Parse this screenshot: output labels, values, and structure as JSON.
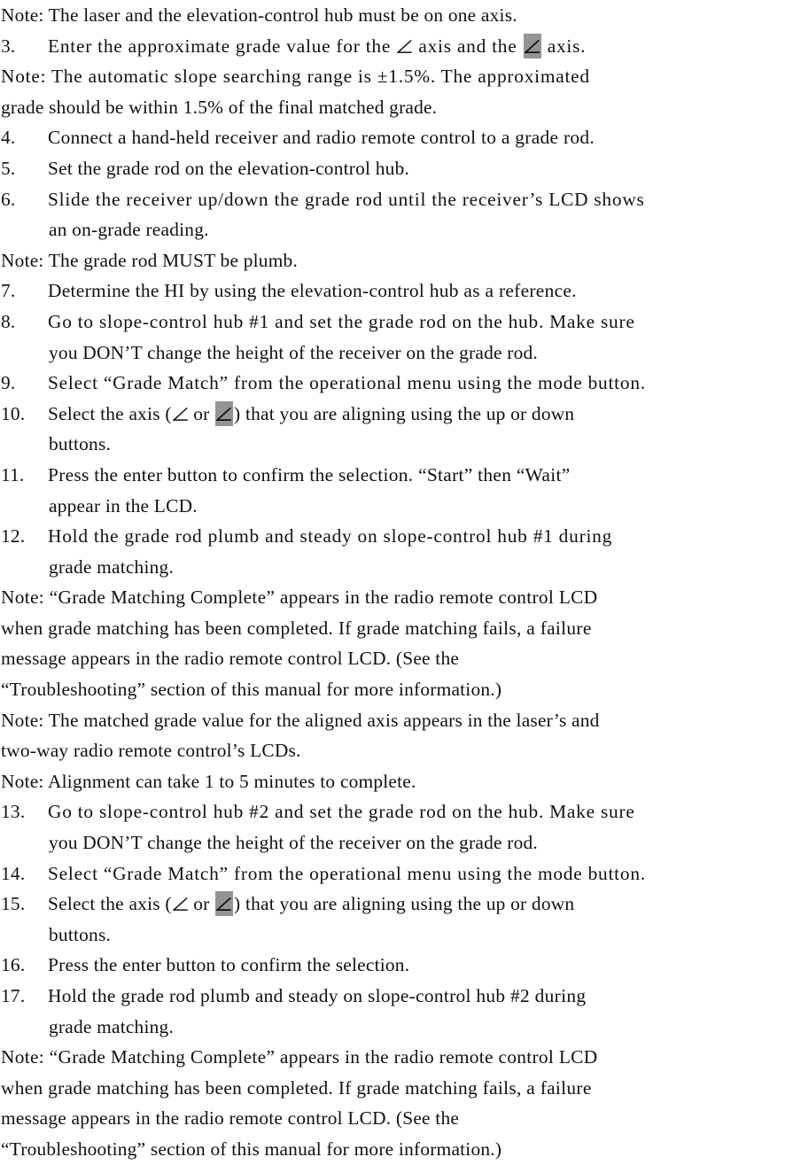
{
  "document": {
    "type": "instruction-manual-page",
    "symbols": {
      "angle_axis": "∠",
      "angle_axis_highlighted": "∠",
      "highlight_color": "#949494"
    },
    "lines": [
      {
        "id": "note-1",
        "kind": "note",
        "text": "Note: The laser and the elevation-control hub must be on one axis."
      },
      {
        "id": "step-3",
        "kind": "step",
        "number": "3.",
        "pre": "Enter the approximate grade value for the",
        "mid": "axis and the",
        "post": "axis.",
        "has_plain_angle": true,
        "has_boxed_angle": true
      },
      {
        "id": "note-2-l1",
        "kind": "note",
        "text": "Note: The automatic slope searching range is ±1.5%. The approximated"
      },
      {
        "id": "note-2-l2",
        "kind": "note-cont",
        "text": "grade should be within 1.5% of the final matched grade."
      },
      {
        "id": "step-4",
        "kind": "step",
        "number": "4.",
        "text": "Connect a hand-held receiver and radio remote control to a grade rod."
      },
      {
        "id": "step-5",
        "kind": "step",
        "number": "5.",
        "text": "Set the grade rod on the elevation-control hub."
      },
      {
        "id": "step-6-l1",
        "kind": "step",
        "number": "6.",
        "text": "Slide the receiver up/down the grade rod until the receiver’s LCD shows"
      },
      {
        "id": "step-6-l2",
        "kind": "step-cont",
        "text": "an on-grade reading."
      },
      {
        "id": "note-3",
        "kind": "note",
        "text": "Note: The grade rod MUST be plumb."
      },
      {
        "id": "step-7",
        "kind": "step",
        "number": "7.",
        "text": "Determine the HI by using the elevation-control hub as a reference."
      },
      {
        "id": "step-8-l1",
        "kind": "step",
        "number": "8.",
        "text": "Go to slope-control hub #1 and set the grade rod on the hub. Make sure"
      },
      {
        "id": "step-8-l2",
        "kind": "step-cont",
        "text": "you DON’T change the height of the receiver on the grade rod."
      },
      {
        "id": "step-9",
        "kind": "step",
        "number": "9.",
        "text": "Select “Grade Match” from the operational menu using the mode button."
      },
      {
        "id": "step-10-l1",
        "kind": "step",
        "number": "10.",
        "pre": "Select the axis (",
        "mid": "or",
        "post": ") that you are aligning using the up or down",
        "has_plain_angle": true,
        "has_boxed_angle": true
      },
      {
        "id": "step-10-l2",
        "kind": "step-cont",
        "text": "buttons."
      },
      {
        "id": "step-11-l1",
        "kind": "step",
        "number": "11.",
        "text": "Press the enter button to confirm the selection. “Start” then “Wait”"
      },
      {
        "id": "step-11-l2",
        "kind": "step-cont",
        "text": "appear in the LCD."
      },
      {
        "id": "step-12-l1",
        "kind": "step",
        "number": "12.",
        "text": "Hold the grade rod plumb and steady on slope-control hub #1 during"
      },
      {
        "id": "step-12-l2",
        "kind": "step-cont",
        "text": "grade matching."
      },
      {
        "id": "note-4-l1",
        "kind": "note",
        "text": "Note: “Grade Matching Complete” appears in the radio remote control LCD"
      },
      {
        "id": "note-4-l2",
        "kind": "note-cont",
        "text": "when grade matching has been completed. If grade matching fails, a failure"
      },
      {
        "id": "note-4-l3",
        "kind": "note-cont",
        "text": "message appears in the radio remote control LCD. (See the"
      },
      {
        "id": "note-4-l4",
        "kind": "note-cont",
        "text": "“Troubleshooting” section of this manual for more information.)"
      },
      {
        "id": "note-5-l1",
        "kind": "note",
        "text": "Note: The matched grade value for the aligned axis appears in the laser’s and"
      },
      {
        "id": "note-5-l2",
        "kind": "note-cont",
        "text": "two-way radio remote control’s LCDs."
      },
      {
        "id": "note-6",
        "kind": "note",
        "text": "Note: Alignment can take 1 to 5 minutes to complete."
      },
      {
        "id": "step-13-l1",
        "kind": "step",
        "number": "13.",
        "text": "Go to slope-control hub #2 and set the grade rod on the hub. Make sure"
      },
      {
        "id": "step-13-l2",
        "kind": "step-cont",
        "text": "you DON’T change the height of the receiver on the grade rod."
      },
      {
        "id": "step-14",
        "kind": "step",
        "number": "14.",
        "text": "Select “Grade Match” from the operational menu using the mode button."
      },
      {
        "id": "step-15-l1",
        "kind": "step",
        "number": "15.",
        "pre": "Select the axis (",
        "mid": "or",
        "post": ") that you are aligning using the up or down",
        "has_plain_angle": true,
        "has_boxed_angle": true
      },
      {
        "id": "step-15-l2",
        "kind": "step-cont",
        "text": "buttons."
      },
      {
        "id": "step-16",
        "kind": "step",
        "number": "16.",
        "text": "Press the enter button to confirm the selection."
      },
      {
        "id": "step-17-l1",
        "kind": "step",
        "number": "17.",
        "text": "Hold the grade rod plumb and steady on slope-control hub #2 during"
      },
      {
        "id": "step-17-l2",
        "kind": "step-cont",
        "text": "grade matching."
      },
      {
        "id": "note-7-l1",
        "kind": "note",
        "text": "Note: “Grade Matching Complete” appears in the radio remote control LCD"
      },
      {
        "id": "note-7-l2",
        "kind": "note-cont",
        "text": "when grade matching has been completed. If grade matching fails, a failure"
      },
      {
        "id": "note-7-l3",
        "kind": "note-cont",
        "text": "message appears in the radio remote control LCD. (See the"
      },
      {
        "id": "note-7-l4",
        "kind": "note-cont",
        "text": "“Troubleshooting” section of this manual for more information.)"
      }
    ]
  }
}
